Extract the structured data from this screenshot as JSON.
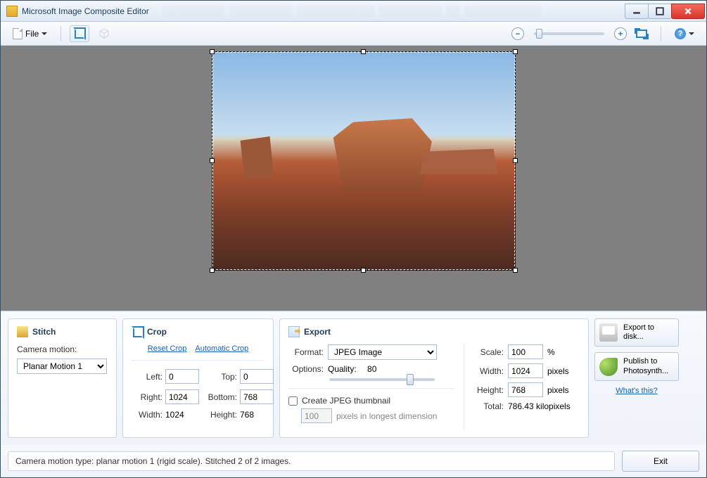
{
  "window": {
    "title": "Microsoft Image Composite Editor"
  },
  "toolbar": {
    "file_label": "File"
  },
  "stitch": {
    "title": "Stitch",
    "camera_motion_label": "Camera motion:",
    "camera_motion_value": "Planar Motion 1"
  },
  "crop": {
    "title": "Crop",
    "reset_link": "Reset Crop",
    "auto_link": "Automatic Crop",
    "left_label": "Left:",
    "left": "0",
    "top_label": "Top:",
    "top": "0",
    "right_label": "Right:",
    "right": "1024",
    "bottom_label": "Bottom:",
    "bottom": "768",
    "width_label": "Width:",
    "width": "1024",
    "height_label": "Height:",
    "height": "768"
  },
  "export": {
    "title": "Export",
    "format_label": "Format:",
    "format_value": "JPEG Image",
    "options_label": "Options:",
    "quality_label": "Quality:",
    "quality_value": "80",
    "thumb_cb_label": "Create JPEG thumbnail",
    "thumb_px": "100",
    "thumb_px_label": "pixels in longest dimension",
    "scale_label": "Scale:",
    "scale": "100",
    "scale_unit": "%",
    "width_label": "Width:",
    "width": "1024",
    "px": "pixels",
    "height_label": "Height:",
    "height": "768",
    "total_label": "Total:",
    "total": "786.43 kilopixels"
  },
  "side": {
    "export_disk": "Export to disk...",
    "publish": "Publish to Photosynth...",
    "whats_this": "What's this?"
  },
  "status": {
    "text": "Camera motion type: planar motion 1 (rigid scale). Stitched 2 of 2 images."
  },
  "exit": {
    "label": "Exit"
  }
}
